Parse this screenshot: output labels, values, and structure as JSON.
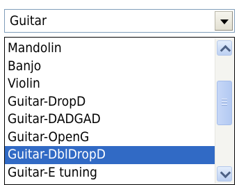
{
  "combo": {
    "value": "Guitar",
    "dropdown_icon": "triangle-down-icon"
  },
  "list": {
    "items": [
      "Mandolin",
      "Banjo",
      "Violin",
      "Guitar-DropD",
      "Guitar-DADGAD",
      "Guitar-OpenG",
      "Guitar-DblDropD",
      "Guitar-E tuning"
    ],
    "selected_index": 6
  },
  "scrollbar": {
    "up_icon": "chevron-up-icon",
    "down_icon": "chevron-down-icon"
  },
  "colors": {
    "selection": "#316ac5",
    "border": "#7f9db9"
  }
}
